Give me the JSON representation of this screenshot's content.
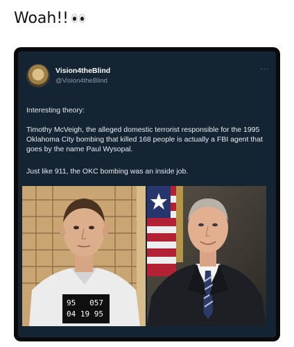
{
  "post": {
    "caption": "Woah!!",
    "emoji_icon": "eyes-icon"
  },
  "tweet": {
    "author_name": "Vision4theBlind",
    "author_handle": "@Vision4theBlind",
    "more_icon": "more-dots-icon",
    "paragraphs": [
      "Interesting theory:",
      "Timothy McVeigh, the alleged domestic terrorist responsible for the 1995 Oklahoma City bombing that killed 168 people is actually a FBI agent that goes by the name Paul Wysopal.",
      "Just like 911, the OKC bombing was an inside job."
    ],
    "mugshot_placard": {
      "line1": "95   057",
      "line2": "04 19 95"
    }
  },
  "colors": {
    "card_bg": "#152433",
    "text": "#e7edf3",
    "handle": "#8a9aab"
  }
}
